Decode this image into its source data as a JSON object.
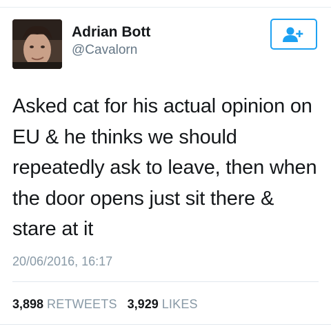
{
  "tweet": {
    "display_name": "Adrian Bott",
    "handle": "@Cavalorn",
    "text": "Asked cat for his actual opinion on EU & he thinks we should repeatedly ask to leave, then when the door opens just sit there & stare at it",
    "timestamp": "20/06/2016, 16:17",
    "retweets_count": "3,898",
    "retweets_label": "RETWEETS",
    "likes_count": "3,929",
    "likes_label": "LIKES"
  },
  "icons": {
    "follow": "add-user-icon",
    "avatar": "profile-photo"
  },
  "colors": {
    "accent": "#1da1f2",
    "text": "#14171a",
    "muted": "#8899a6"
  }
}
